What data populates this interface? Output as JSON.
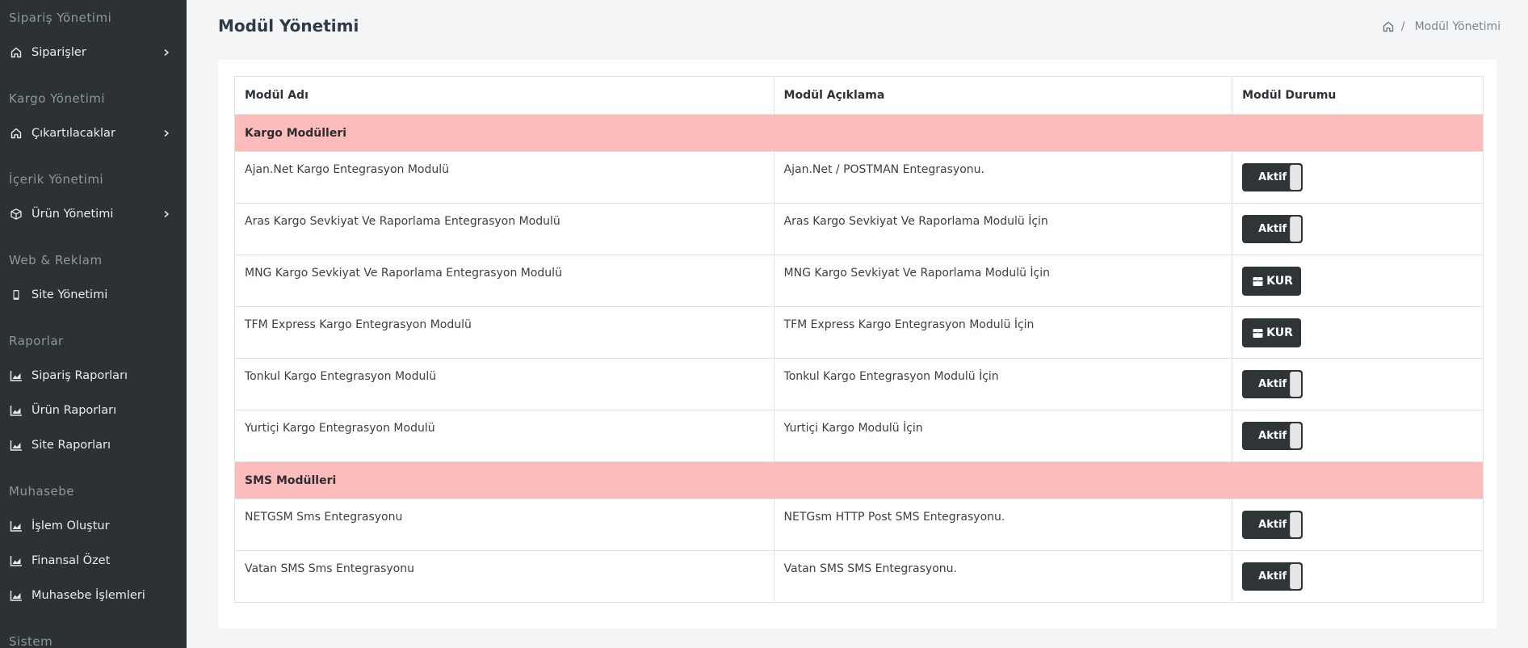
{
  "sidebar": {
    "sections": [
      {
        "title": "Sipariş Yönetimi",
        "items": [
          {
            "label": "Siparişler",
            "icon": "home-icon",
            "chevron": true
          }
        ]
      },
      {
        "title": "Kargo Yönetimi",
        "items": [
          {
            "label": "Çıkartılacaklar",
            "icon": "home-icon",
            "chevron": true
          }
        ]
      },
      {
        "title": "İçerik Yönetimi",
        "items": [
          {
            "label": "Ürün Yönetimi",
            "icon": "box-icon",
            "chevron": true
          }
        ]
      },
      {
        "title": "Web & Reklam",
        "items": [
          {
            "label": "Site Yönetimi",
            "icon": "mobile-icon",
            "chevron": false
          }
        ]
      },
      {
        "title": "Raporlar",
        "items": [
          {
            "label": "Sipariş Raporları",
            "icon": "chart-icon",
            "chevron": false
          },
          {
            "label": "Ürün Raporları",
            "icon": "chart-icon",
            "chevron": false
          },
          {
            "label": "Site Raporları",
            "icon": "chart-icon",
            "chevron": false
          }
        ]
      },
      {
        "title": "Muhasebe",
        "items": [
          {
            "label": "İşlem Oluştur",
            "icon": "chart-icon",
            "chevron": false
          },
          {
            "label": "Finansal Özet",
            "icon": "chart-icon",
            "chevron": false
          },
          {
            "label": "Muhasebe İşlemleri",
            "icon": "chart-icon",
            "chevron": false
          }
        ]
      },
      {
        "title": "Sistem",
        "items": []
      }
    ]
  },
  "header": {
    "title": "Modül Yönetimi",
    "breadcrumb": {
      "separator": "/",
      "current": "Modül Yönetimi"
    }
  },
  "table": {
    "columns": [
      "Modül Adı",
      "Modül Açıklama",
      "Modül Durumu"
    ],
    "groups": [
      {
        "title": "Kargo Modülleri",
        "rows": [
          {
            "name": "Ajan.Net Kargo Entegrasyon Modulü",
            "description": "Ajan.Net / POSTMAN Entegrasyonu.",
            "status": "active"
          },
          {
            "name": "Aras Kargo Sevkiyat Ve Raporlama Entegrasyon Modulü",
            "description": "Aras Kargo Sevkiyat Ve Raporlama Modulü İçin",
            "status": "active"
          },
          {
            "name": "MNG Kargo Sevkiyat Ve Raporlama Entegrasyon Modulü",
            "description": "MNG Kargo Sevkiyat Ve Raporlama Modulü İçin",
            "status": "install"
          },
          {
            "name": "TFM Express Kargo Entegrasyon Modulü",
            "description": "TFM Express Kargo Entegrasyon Modulü İçin",
            "status": "install"
          },
          {
            "name": "Tonkul Kargo Entegrasyon Modulü",
            "description": "Tonkul Kargo Entegrasyon Modulü İçin",
            "status": "active"
          },
          {
            "name": "Yurtiçi Kargo Entegrasyon Modulü",
            "description": "Yurtiçi Kargo Modulü İçin",
            "status": "active"
          }
        ]
      },
      {
        "title": "SMS Modülleri",
        "rows": [
          {
            "name": "NETGSM Sms Entegrasyonu",
            "description": "NETGsm HTTP Post SMS Entegrasyonu.",
            "status": "active"
          },
          {
            "name": "Vatan SMS Sms Entegrasyonu",
            "description": "Vatan SMS SMS Entegrasyonu.",
            "status": "active"
          }
        ]
      }
    ],
    "labels": {
      "active": "Aktif",
      "install": "KUR"
    }
  },
  "colors": {
    "sidebar_bg": "#2c3234",
    "group_row_bg": "#fdbcbc",
    "button_bg": "#2f3537"
  }
}
